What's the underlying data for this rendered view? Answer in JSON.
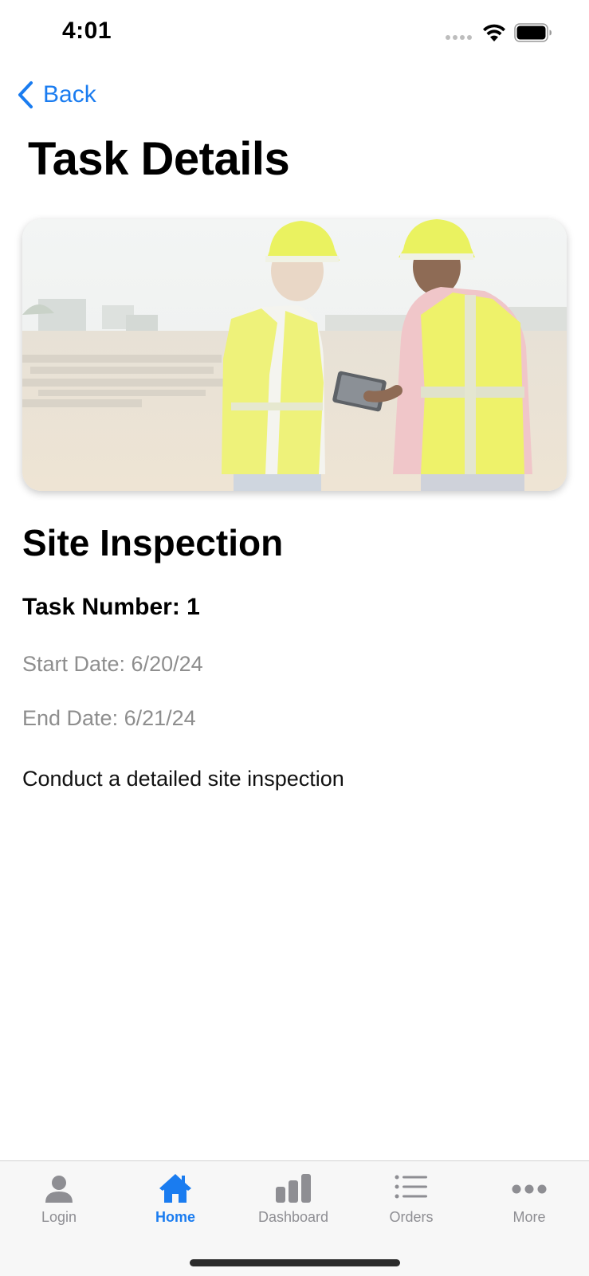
{
  "status_bar": {
    "time": "4:01"
  },
  "nav": {
    "back_label": "Back",
    "title": "Task Details"
  },
  "task": {
    "title": "Site Inspection",
    "number": "Task Number: 1",
    "start_date": "Start Date: 6/20/24",
    "end_date": "End Date: 6/21/24",
    "description": "Conduct a detailed site inspection"
  },
  "tab_bar": {
    "items": [
      {
        "label": "Login",
        "icon": "person-icon"
      },
      {
        "label": "Home",
        "icon": "house-icon",
        "active": true
      },
      {
        "label": "Dashboard",
        "icon": "bar-chart-icon"
      },
      {
        "label": "Orders",
        "icon": "list-icon"
      },
      {
        "label": "More",
        "icon": "ellipsis-icon"
      }
    ]
  },
  "colors": {
    "accent": "#1a7cf0",
    "inactive_tab": "#8e8e93",
    "secondary_text": "#8e8e8e"
  }
}
